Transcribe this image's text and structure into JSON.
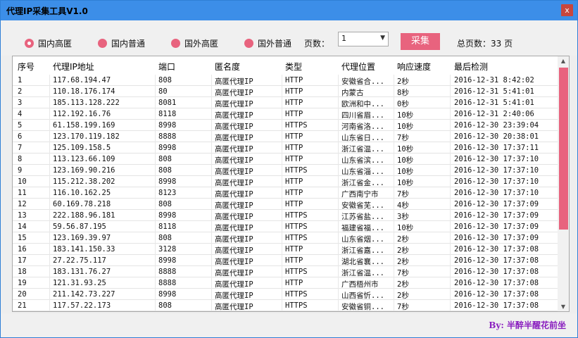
{
  "window": {
    "title": "代理IP采集工具V1.0",
    "close_label": "x"
  },
  "controls": {
    "radios": [
      {
        "label": "国内高匿",
        "checked": true
      },
      {
        "label": "国内普通",
        "checked": false
      },
      {
        "label": "国外高匿",
        "checked": false
      },
      {
        "label": "国外普通",
        "checked": false
      }
    ],
    "pages_label": "页数：",
    "page_select_value": "1",
    "collect_button": "采集",
    "total_pages_label": "总页数：33  页"
  },
  "table": {
    "columns": [
      "序号",
      "代理IP地址",
      "端口",
      "匿名度",
      "类型",
      "代理位置",
      "响应速度",
      "最后检测"
    ],
    "rows": [
      [
        "1",
        "117.68.194.47",
        "808",
        "高匿代理IP",
        "HTTP",
        "安徽省合...",
        "2秒",
        "2016-12-31  8:42:02"
      ],
      [
        "2",
        "110.18.176.174",
        "80",
        "高匿代理IP",
        "HTTP",
        "内蒙古",
        "8秒",
        "2016-12-31  5:41:01"
      ],
      [
        "3",
        "185.113.128.222",
        "8081",
        "高匿代理IP",
        "HTTP",
        "欧洲和中...",
        "0秒",
        "2016-12-31  5:41:01"
      ],
      [
        "4",
        "112.192.16.76",
        "8118",
        "高匿代理IP",
        "HTTP",
        "四川省眉...",
        "10秒",
        "2016-12-31  2:40:06"
      ],
      [
        "5",
        "61.158.199.169",
        "8998",
        "高匿代理IP",
        "HTTPS",
        "河南省洛...",
        "10秒",
        "2016-12-30  23:39:04"
      ],
      [
        "6",
        "123.170.119.182",
        "8888",
        "高匿代理IP",
        "HTTP",
        "山东省日...",
        "7秒",
        "2016-12-30  20:38:01"
      ],
      [
        "7",
        "125.109.158.5",
        "8998",
        "高匿代理IP",
        "HTTP",
        "浙江省温...",
        "10秒",
        "2016-12-30  17:37:11"
      ],
      [
        "8",
        "113.123.66.109",
        "808",
        "高匿代理IP",
        "HTTP",
        "山东省滨...",
        "10秒",
        "2016-12-30  17:37:10"
      ],
      [
        "9",
        "123.169.90.216",
        "808",
        "高匿代理IP",
        "HTTPS",
        "山东省淄...",
        "10秒",
        "2016-12-30  17:37:10"
      ],
      [
        "10",
        "115.212.38.202",
        "8998",
        "高匿代理IP",
        "HTTP",
        "浙江省金...",
        "10秒",
        "2016-12-30  17:37:10"
      ],
      [
        "11",
        "116.10.162.25",
        "8123",
        "高匿代理IP",
        "HTTP",
        "广西南宁市",
        "7秒",
        "2016-12-30  17:37:10"
      ],
      [
        "12",
        "60.169.78.218",
        "808",
        "高匿代理IP",
        "HTTP",
        "安徽省芜...",
        "4秒",
        "2016-12-30  17:37:09"
      ],
      [
        "13",
        "222.188.96.181",
        "8998",
        "高匿代理IP",
        "HTTPS",
        "江苏省盐...",
        "3秒",
        "2016-12-30  17:37:09"
      ],
      [
        "14",
        "59.56.87.195",
        "8118",
        "高匿代理IP",
        "HTTPS",
        "福建省福...",
        "10秒",
        "2016-12-30  17:37:09"
      ],
      [
        "15",
        "123.169.39.97",
        "808",
        "高匿代理IP",
        "HTTPS",
        "山东省烟...",
        "2秒",
        "2016-12-30  17:37:09"
      ],
      [
        "16",
        "183.141.150.33",
        "3128",
        "高匿代理IP",
        "HTTP",
        "浙江省嘉...",
        "2秒",
        "2016-12-30  17:37:08"
      ],
      [
        "17",
        "27.22.75.117",
        "8998",
        "高匿代理IP",
        "HTTP",
        "湖北省襄...",
        "2秒",
        "2016-12-30  17:37:08"
      ],
      [
        "18",
        "183.131.76.27",
        "8888",
        "高匿代理IP",
        "HTTPS",
        "浙江省温...",
        "7秒",
        "2016-12-30  17:37:08"
      ],
      [
        "19",
        "121.31.93.25",
        "8888",
        "高匿代理IP",
        "HTTP",
        "广西梧州市",
        "2秒",
        "2016-12-30  17:37:08"
      ],
      [
        "20",
        "211.142.73.227",
        "8998",
        "高匿代理IP",
        "HTTPS",
        "山西省忻...",
        "2秒",
        "2016-12-30  17:37:08"
      ],
      [
        "21",
        "117.57.22.173",
        "808",
        "高匿代理IP",
        "HTTPS",
        "安徽省铜...",
        "7秒",
        "2016-12-30  17:37:08"
      ]
    ]
  },
  "footer": {
    "author": "By: 半醉半醒花前坐"
  },
  "colors": {
    "accent": "#e8637e",
    "titlebar": "#3c8ee8",
    "author": "#8a1fbf"
  }
}
